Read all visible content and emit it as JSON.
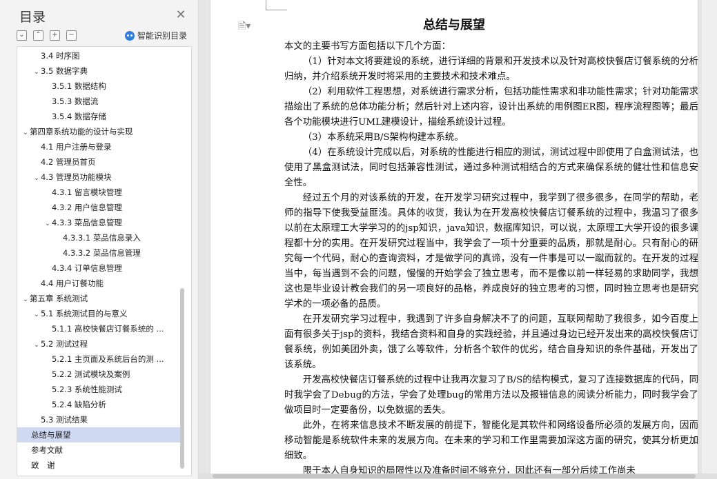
{
  "nav": {
    "title": "目录",
    "smart_label": "智能识别目录",
    "toolbar": [
      "collapse",
      "expand-up",
      "add",
      "remove"
    ],
    "items": [
      {
        "label": "3.4 时序图",
        "level": 2,
        "chev": false
      },
      {
        "label": "3.5 数据字典",
        "level": 2,
        "chev": true
      },
      {
        "label": "3.5.1 数据结构",
        "level": 3,
        "chev": false
      },
      {
        "label": "3.5.3 数据流",
        "level": 3,
        "chev": false
      },
      {
        "label": "3.5.4 数据存储",
        "level": 3,
        "chev": false
      },
      {
        "label": "第四章系统功能的设计与实现",
        "level": 1,
        "chev": true
      },
      {
        "label": "4.1 用户注册与登录",
        "level": 2,
        "chev": false
      },
      {
        "label": "4.2 管理员首页",
        "level": 2,
        "chev": false
      },
      {
        "label": "4.3 管理员功能模块",
        "level": 2,
        "chev": true
      },
      {
        "label": "4.3.1 留言模块管理",
        "level": 3,
        "chev": false
      },
      {
        "label": "4.3.2 用户信息管理",
        "level": 3,
        "chev": false
      },
      {
        "label": "4.3.3 菜品信息管理",
        "level": 3,
        "chev": true
      },
      {
        "label": "4.3.3.1 菜品信息录入",
        "level": 4,
        "chev": false
      },
      {
        "label": "4.3.3.2 菜品信息管理",
        "level": 4,
        "chev": false
      },
      {
        "label": "4.3.4 订单信息管理",
        "level": 3,
        "chev": false
      },
      {
        "label": "4.4 用户订餐功能",
        "level": 2,
        "chev": false
      },
      {
        "label": "第五章 系统测试",
        "level": 1,
        "chev": true
      },
      {
        "label": "5.1 系统测试目的与意义",
        "level": 2,
        "chev": true
      },
      {
        "label": "5.1.1 高校快餐店订餐系统的 ...",
        "level": 3,
        "chev": false
      },
      {
        "label": "5.2 测试过程",
        "level": 2,
        "chev": true
      },
      {
        "label": "5.2.1 主页面及系统后台的测 ...",
        "level": 3,
        "chev": false
      },
      {
        "label": "5.2.2 测试模块及案例",
        "level": 3,
        "chev": false
      },
      {
        "label": "5.2.3 系统性能测试",
        "level": 3,
        "chev": false
      },
      {
        "label": "5.2.4 缺陷分析",
        "level": 3,
        "chev": false
      },
      {
        "label": "5.3 测试结果",
        "level": 2,
        "chev": false
      },
      {
        "label": "总结与展望",
        "level": 0,
        "chev": false,
        "selected": true
      },
      {
        "label": "参考文献",
        "level": 0,
        "chev": false
      },
      {
        "label": "致　谢",
        "level": 0,
        "chev": false
      }
    ]
  },
  "doc": {
    "title": "总结与展望",
    "paragraphs": [
      "本文的主要书写方面包括以下几个方面：",
      "（1）针对本文将要建设的系统，进行详细的背景和开发技术以及针对高校快餐店订餐系统的分析归纳，并介绍系统开发时将采用的主要技术和技术难点。",
      "（2）利用软件工程思想，对系统进行需求分析，包括功能性需求和非功能性需求；针对功能需求描绘出了系统的总体功能分析；然后针对上述内容，设计出系统的用例图ER图，程序流程图等；最后各个功能模块进行UML建模设计，描绘系统设计过程。",
      "（3）本系统采用B/S架构构建本系统。",
      "（4）在系统设计完成以后，对系统的性能进行相应的测试，测试过程中即使用了白盒测试法，也使用了黑盒测试法，同时包括兼容性测试，通过多种测试相结合的方式来确保系统的健壮性和信息安全性。",
      "经过五个月的对该系统的开发，在开发学习研究过程中，我学到了很多很多，在同学的帮助，老师的指导下使我受益匪浅。具体的收货，我认为在开发高校快餐店订餐系统的过程中，我温习了很多以前在太原理工大学学习的的jsp知识，java知识，数据库知识，可以说，太原理工大学开设的很多课程都十分的实用。在开发研究过程当中，我学会了一项十分重要的品质，那就是耐心。只有耐心的研究每一个代码，耐心的查询资料，才是做学问的真谛，没有一件事是可以一蹴而就的。在开发的过程当中，每当遇到不会的问题，慢慢的开始学会了独立思考，而不是像以前一样轻易的求助同学，我想这也是毕业设计教会我们的另一项良好的品格，养成良好的独立思考的习惯，同时独立思考也是研究学术的一项必备的品质。",
      "在开发研究学习过程中，我遇到了许多自身解决不了的问题，互联网帮助了我很多，如今百度上面有很多关于jsp的资料，我结合资料和自身的实践经验，并且通过身边已经开发出来的高校快餐店订餐系统，例如美团外卖，饿了么等软件，分析各个软件的优劣，结合自身知识的条件基础，开发出了该系统。",
      "开发高校快餐店订餐系统的过程中让我再次复习了B/S的结构模式，复习了连接数据库的代码，同时我学会了Debug的方法，学会了处理bug的常用方法以及报错信息的阅读分析能力，同时我学会了做项目时一定要备份，以免数据的丢失。",
      "此外，在将来信息技术不断发展的前提下，智能化是其软件和网络设备所必须的发展方向，因而移动智能是系统软件未来的发展方向。在未来的学习和工作里需要加深这方面的研究，使其分析更加细致。",
      "限于本人自身知识的局限性以及准备时间不够充分，因此还有一部分后续工作尚未"
    ]
  }
}
